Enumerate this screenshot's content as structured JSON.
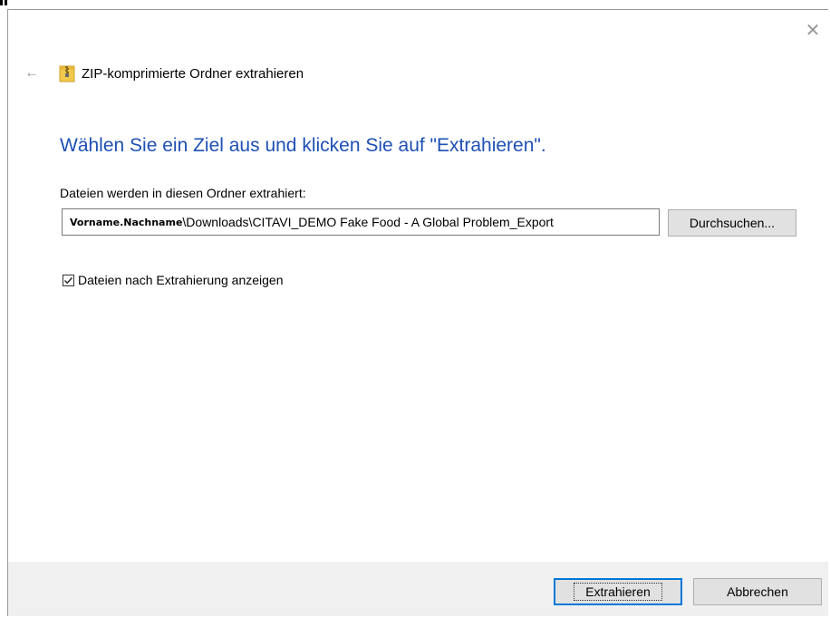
{
  "window": {
    "title": "ZIP-komprimierte Ordner extrahieren",
    "heading": "Wählen Sie ein Ziel aus und klicken Sie auf \"Extrahieren\".",
    "close_glyph": "✕",
    "back_glyph": "←"
  },
  "destination": {
    "label": "Dateien werden in diesen Ordner extrahiert:",
    "path_user": "Vorname.Nachname",
    "path_rest": "\\Downloads\\CITAVI_DEMO Fake Food - A Global Problem_Export",
    "browse_label": "Durchsuchen..."
  },
  "options": {
    "show_files_label": "Dateien nach Extrahierung anzeigen",
    "show_files_checked": true
  },
  "footer": {
    "extract_label": "Extrahieren",
    "cancel_label": "Abbrechen"
  },
  "icons": {
    "title_icon": "zip-folder-icon",
    "close_icon": "close-icon",
    "back_icon": "back-arrow-icon",
    "check_icon": "checkmark-icon"
  },
  "colors": {
    "heading": "#1e50b4",
    "accent_focus": "#0078d7",
    "footer_bg": "#f0f0f0",
    "button_bg": "#e1e1e1"
  }
}
